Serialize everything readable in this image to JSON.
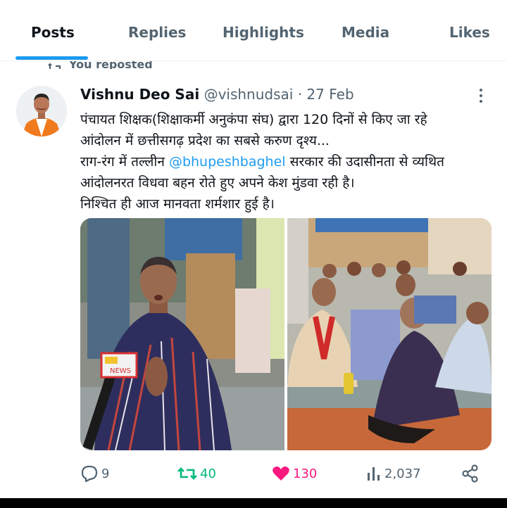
{
  "tabs": [
    {
      "label": "Posts",
      "active": true
    },
    {
      "label": "Replies",
      "active": false
    },
    {
      "label": "Highlights",
      "active": false
    },
    {
      "label": "Media",
      "active": false
    },
    {
      "label": "Likes",
      "active": false
    }
  ],
  "repost_banner": {
    "label": "You reposted",
    "icon": "repost-icon"
  },
  "tweet": {
    "author_name": "Vishnu Deo Sai",
    "handle": "@vishnudsai",
    "separator": "·",
    "date": "27 Feb",
    "text": {
      "line1": "पंचायत शिक्षक(शिक्षाकर्मी अनुकंपा संघ) द्वारा 120 दिनों से किए जा रहे",
      "line2": "आंदोलन में छत्तीसगढ़ प्रदेश का सबसे करुण दृश्य...",
      "line3_before": "राग-रंग में तल्लीन ",
      "line3_mention": "@bhupeshbaghel",
      "line3_after": " सरकार की उदासीनता से व्यथित",
      "line4": "आंदोलनरत विधवा बहन रोते हुए अपने केश मुंडवा रही है।",
      "line5": "निश्चित ही आज मानवता शर्मशार हुई है।"
    },
    "photo1_mic_text": "NEWS",
    "stats": {
      "replies": "9",
      "reposts": "40",
      "likes": "130",
      "views": "2,037"
    }
  },
  "colors": {
    "accent": "#1d9bf0",
    "repost_green": "#00ba7c",
    "like_pink": "#f91880",
    "secondary_text": "#536471"
  }
}
